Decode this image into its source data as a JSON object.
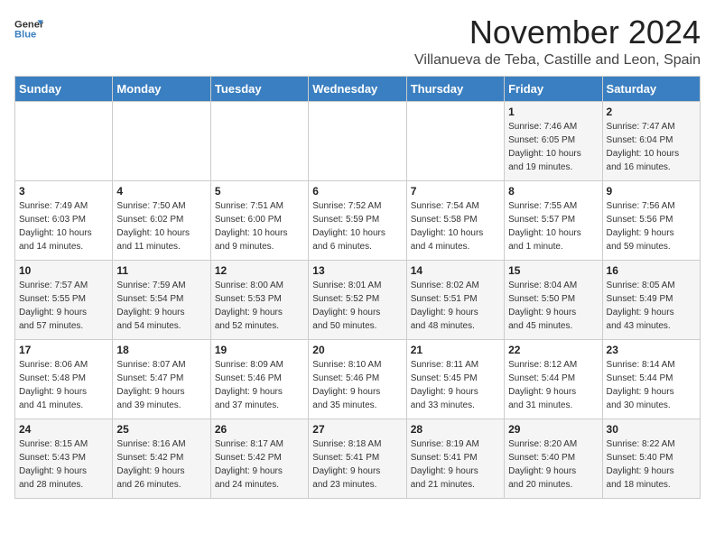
{
  "header": {
    "logo_general": "General",
    "logo_blue": "Blue",
    "month_title": "November 2024",
    "location": "Villanueva de Teba, Castille and Leon, Spain"
  },
  "weekdays": [
    "Sunday",
    "Monday",
    "Tuesday",
    "Wednesday",
    "Thursday",
    "Friday",
    "Saturday"
  ],
  "weeks": [
    [
      {
        "day": "",
        "info": ""
      },
      {
        "day": "",
        "info": ""
      },
      {
        "day": "",
        "info": ""
      },
      {
        "day": "",
        "info": ""
      },
      {
        "day": "",
        "info": ""
      },
      {
        "day": "1",
        "info": "Sunrise: 7:46 AM\nSunset: 6:05 PM\nDaylight: 10 hours\nand 19 minutes."
      },
      {
        "day": "2",
        "info": "Sunrise: 7:47 AM\nSunset: 6:04 PM\nDaylight: 10 hours\nand 16 minutes."
      }
    ],
    [
      {
        "day": "3",
        "info": "Sunrise: 7:49 AM\nSunset: 6:03 PM\nDaylight: 10 hours\nand 14 minutes."
      },
      {
        "day": "4",
        "info": "Sunrise: 7:50 AM\nSunset: 6:02 PM\nDaylight: 10 hours\nand 11 minutes."
      },
      {
        "day": "5",
        "info": "Sunrise: 7:51 AM\nSunset: 6:00 PM\nDaylight: 10 hours\nand 9 minutes."
      },
      {
        "day": "6",
        "info": "Sunrise: 7:52 AM\nSunset: 5:59 PM\nDaylight: 10 hours\nand 6 minutes."
      },
      {
        "day": "7",
        "info": "Sunrise: 7:54 AM\nSunset: 5:58 PM\nDaylight: 10 hours\nand 4 minutes."
      },
      {
        "day": "8",
        "info": "Sunrise: 7:55 AM\nSunset: 5:57 PM\nDaylight: 10 hours\nand 1 minute."
      },
      {
        "day": "9",
        "info": "Sunrise: 7:56 AM\nSunset: 5:56 PM\nDaylight: 9 hours\nand 59 minutes."
      }
    ],
    [
      {
        "day": "10",
        "info": "Sunrise: 7:57 AM\nSunset: 5:55 PM\nDaylight: 9 hours\nand 57 minutes."
      },
      {
        "day": "11",
        "info": "Sunrise: 7:59 AM\nSunset: 5:54 PM\nDaylight: 9 hours\nand 54 minutes."
      },
      {
        "day": "12",
        "info": "Sunrise: 8:00 AM\nSunset: 5:53 PM\nDaylight: 9 hours\nand 52 minutes."
      },
      {
        "day": "13",
        "info": "Sunrise: 8:01 AM\nSunset: 5:52 PM\nDaylight: 9 hours\nand 50 minutes."
      },
      {
        "day": "14",
        "info": "Sunrise: 8:02 AM\nSunset: 5:51 PM\nDaylight: 9 hours\nand 48 minutes."
      },
      {
        "day": "15",
        "info": "Sunrise: 8:04 AM\nSunset: 5:50 PM\nDaylight: 9 hours\nand 45 minutes."
      },
      {
        "day": "16",
        "info": "Sunrise: 8:05 AM\nSunset: 5:49 PM\nDaylight: 9 hours\nand 43 minutes."
      }
    ],
    [
      {
        "day": "17",
        "info": "Sunrise: 8:06 AM\nSunset: 5:48 PM\nDaylight: 9 hours\nand 41 minutes."
      },
      {
        "day": "18",
        "info": "Sunrise: 8:07 AM\nSunset: 5:47 PM\nDaylight: 9 hours\nand 39 minutes."
      },
      {
        "day": "19",
        "info": "Sunrise: 8:09 AM\nSunset: 5:46 PM\nDaylight: 9 hours\nand 37 minutes."
      },
      {
        "day": "20",
        "info": "Sunrise: 8:10 AM\nSunset: 5:46 PM\nDaylight: 9 hours\nand 35 minutes."
      },
      {
        "day": "21",
        "info": "Sunrise: 8:11 AM\nSunset: 5:45 PM\nDaylight: 9 hours\nand 33 minutes."
      },
      {
        "day": "22",
        "info": "Sunrise: 8:12 AM\nSunset: 5:44 PM\nDaylight: 9 hours\nand 31 minutes."
      },
      {
        "day": "23",
        "info": "Sunrise: 8:14 AM\nSunset: 5:44 PM\nDaylight: 9 hours\nand 30 minutes."
      }
    ],
    [
      {
        "day": "24",
        "info": "Sunrise: 8:15 AM\nSunset: 5:43 PM\nDaylight: 9 hours\nand 28 minutes."
      },
      {
        "day": "25",
        "info": "Sunrise: 8:16 AM\nSunset: 5:42 PM\nDaylight: 9 hours\nand 26 minutes."
      },
      {
        "day": "26",
        "info": "Sunrise: 8:17 AM\nSunset: 5:42 PM\nDaylight: 9 hours\nand 24 minutes."
      },
      {
        "day": "27",
        "info": "Sunrise: 8:18 AM\nSunset: 5:41 PM\nDaylight: 9 hours\nand 23 minutes."
      },
      {
        "day": "28",
        "info": "Sunrise: 8:19 AM\nSunset: 5:41 PM\nDaylight: 9 hours\nand 21 minutes."
      },
      {
        "day": "29",
        "info": "Sunrise: 8:20 AM\nSunset: 5:40 PM\nDaylight: 9 hours\nand 20 minutes."
      },
      {
        "day": "30",
        "info": "Sunrise: 8:22 AM\nSunset: 5:40 PM\nDaylight: 9 hours\nand 18 minutes."
      }
    ]
  ]
}
